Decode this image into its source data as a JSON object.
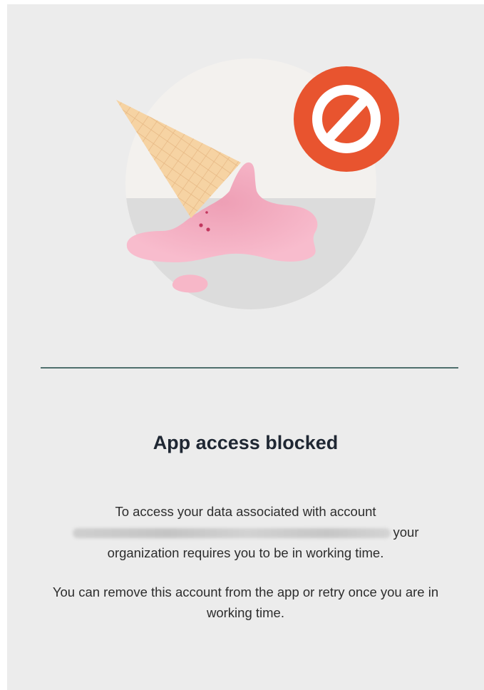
{
  "dialog": {
    "title": "App access blocked",
    "message_line1": "To access your data associated with account",
    "message_after_account": "your",
    "message_line3": "organization requires you to be in working time.",
    "hint_text": "You can remove this account from the app or retry once you are in working time."
  },
  "icons": {
    "illustration": "melted-ice-cream-cone",
    "badge": "blocked-icon"
  },
  "colors": {
    "background": "#ececec",
    "divider": "#4f6f6d",
    "blocked_badge": "#e8542f",
    "ice_cream": "#f7b7c8",
    "cone": "#f4cfa0"
  }
}
